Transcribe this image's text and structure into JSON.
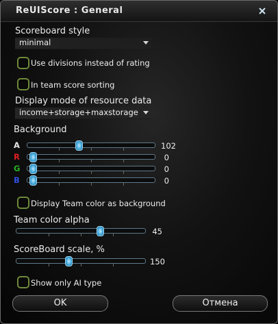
{
  "window": {
    "title": "ReUIScore : General"
  },
  "scoreboard_style": {
    "label": "Scoreboard style",
    "value": "minimal"
  },
  "use_divisions": {
    "label": "Use divisions instead of rating",
    "checked": false
  },
  "team_sorting": {
    "label": "In team score sorting",
    "checked": false
  },
  "resource_mode": {
    "label": "Display mode of resource data",
    "value": "income+storage+maxstorage"
  },
  "background": {
    "label": "Background",
    "channels": [
      {
        "name": "A",
        "value": "102",
        "color": "#e6e6e6",
        "fraction": 0.4
      },
      {
        "name": "R",
        "value": "0",
        "color": "#e02020",
        "fraction": 0.0
      },
      {
        "name": "G",
        "value": "0",
        "color": "#27b027",
        "fraction": 0.0
      },
      {
        "name": "B",
        "value": "0",
        "color": "#2f4fe0",
        "fraction": 0.0
      }
    ]
  },
  "team_color_bg": {
    "label": "Display Team color as background",
    "checked": false
  },
  "team_color_alpha": {
    "label": "Team color alpha",
    "value": "45",
    "fraction": 0.67
  },
  "scoreboard_scale": {
    "label": "ScoreBoard scale, %",
    "value": "150",
    "fraction": 0.4
  },
  "show_ai": {
    "label": "Show only AI type",
    "checked": false
  },
  "buttons": {
    "ok": "OK",
    "cancel": "Отмена"
  },
  "colors": {
    "checkbox_border": "#6f8a3a",
    "slider_knob": "#3aa3d6"
  }
}
